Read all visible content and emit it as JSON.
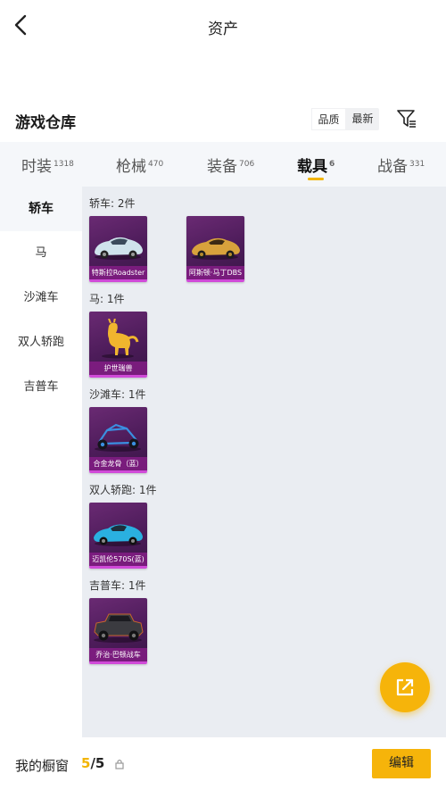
{
  "header": {
    "title": "资产"
  },
  "warehouse": {
    "title": "游戏仓库",
    "sort_options": [
      "品质",
      "最新"
    ]
  },
  "tabs": [
    {
      "label": "时装",
      "count": "1318"
    },
    {
      "label": "枪械",
      "count": "470"
    },
    {
      "label": "装备",
      "count": "706"
    },
    {
      "label": "载具",
      "count": "6"
    },
    {
      "label": "战备",
      "count": "331"
    }
  ],
  "active_tab": "载具",
  "sidebar": {
    "items": [
      "轿车",
      "马",
      "沙滩车",
      "双人轿跑",
      "吉普车"
    ]
  },
  "sections": [
    {
      "title": "轿车: 2件",
      "items": [
        "特斯拉Roadster",
        "阿斯顿·马丁DBS"
      ]
    },
    {
      "title": "马: 1件",
      "items": [
        "护世瑞兽"
      ]
    },
    {
      "title": "沙滩车: 1件",
      "items": [
        "合金龙骨（蓝）"
      ]
    },
    {
      "title": "双人轿跑: 1件",
      "items": [
        "迈凯伦570S(蓝)"
      ]
    },
    {
      "title": "吉普车: 1件",
      "items": [
        "乔治·巴顿战车"
      ]
    }
  ],
  "bottom": {
    "label": "我的橱窗",
    "current": "5",
    "total": "/5",
    "edit": "编辑"
  },
  "colors": {
    "accent": "#f6b40a",
    "card_bg": "#5a2166",
    "card_rarity": "#d04ad8"
  }
}
